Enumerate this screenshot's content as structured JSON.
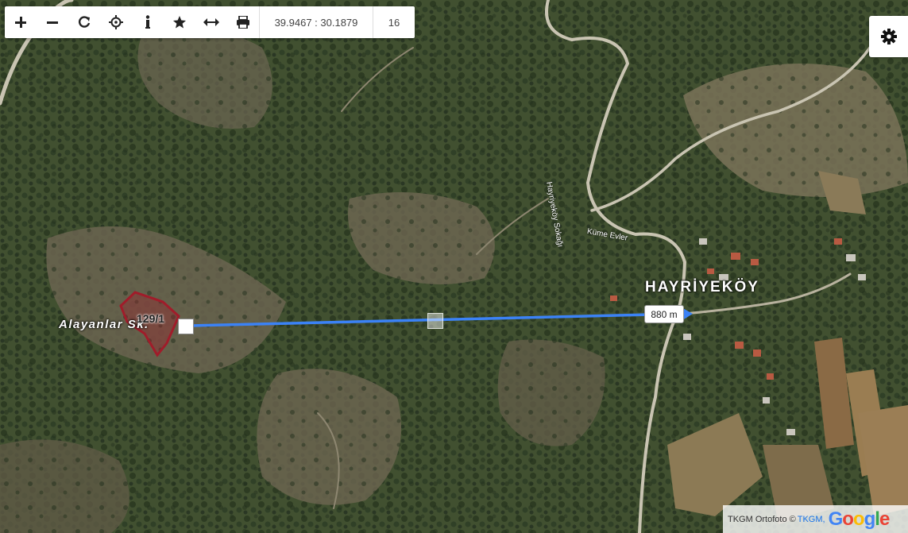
{
  "toolbar": {
    "buttons": [
      {
        "name": "zoom-in-button",
        "icon": "plus-icon"
      },
      {
        "name": "zoom-out-button",
        "icon": "minus-icon"
      },
      {
        "name": "refresh-button",
        "icon": "refresh-icon"
      },
      {
        "name": "locate-button",
        "icon": "crosshair-icon"
      },
      {
        "name": "info-button",
        "icon": "info-icon"
      },
      {
        "name": "favorite-button",
        "icon": "star-icon"
      },
      {
        "name": "measure-button",
        "icon": "arrows-horizontal-icon"
      },
      {
        "name": "print-button",
        "icon": "printer-icon"
      }
    ],
    "coordinates": "39.9467 : 30.1879",
    "zoom_level": "16"
  },
  "settings": {
    "icon": "gear-icon"
  },
  "map": {
    "village_label": "HAYRİYEKÖY",
    "street_label": "Alayanlar Sk.",
    "parcel_label": "129/1",
    "road_label_1": "Hayriyeköy Sokağı",
    "road_label_2": "Küme Evler",
    "distance_label": "880 m",
    "measure_color": "#3b82f6",
    "parcel_color": "#a01c2a"
  },
  "attribution": {
    "source_text": "TKGM Ortofoto ©",
    "link_text": "TKGM,",
    "brand": "Google"
  }
}
